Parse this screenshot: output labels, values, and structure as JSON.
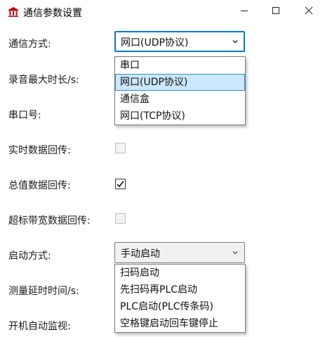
{
  "window": {
    "title": "通信参数设置"
  },
  "form": {
    "comm_mode_label": "通信方式:",
    "max_record_label": "录音最大时长/s:",
    "serial_port_label": "串口号:",
    "realtime_label": "实时数据回传:",
    "total_label": "总值数据回传:",
    "over_bw_label": "超标带宽数据回传:",
    "start_mode_label": "启动方式:",
    "delay_label": "测量延时时间/s:",
    "autostart_label": "开机自动监视:"
  },
  "comm_mode": {
    "value": "网口(UDP协议)",
    "options": [
      "串口",
      "网口(UDP协议)",
      "通信盒",
      "网口(TCP协议)"
    ],
    "selected_index": 1
  },
  "checkboxes": {
    "realtime": false,
    "total": true,
    "over_bw": false
  },
  "start_mode": {
    "value": "手动启动",
    "options": [
      "扫码启动",
      "先扫码再PLC启动",
      "PLC启动(PLC传条码)",
      "空格键启动回车键停止"
    ]
  },
  "colors": {
    "accent": "#0078d7",
    "selection": "#cce8ff",
    "icon": "#c00000"
  },
  "icons": {
    "app": "bank-icon",
    "minimize": "minimize-icon",
    "maximize": "maximize-icon",
    "close": "close-icon",
    "chevron": "chevron-down-icon",
    "check": "checkmark-icon"
  }
}
